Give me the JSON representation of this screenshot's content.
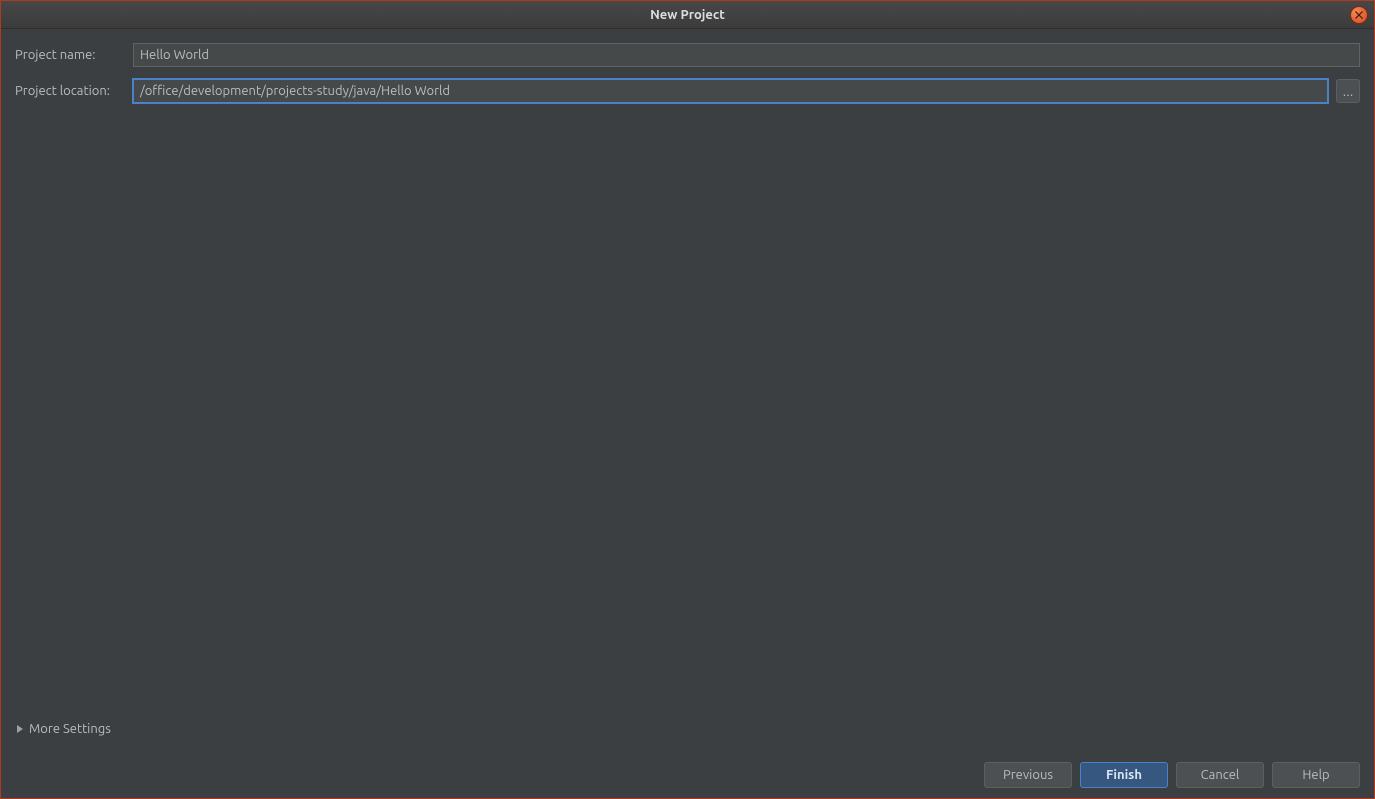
{
  "window": {
    "title": "New Project"
  },
  "form": {
    "project_name_label": "Project name:",
    "project_name_value": "Hello World",
    "project_location_label": "Project location:",
    "project_location_value": "/office/development/projects-study/java/Hello World",
    "browse_label": "..."
  },
  "more_settings": {
    "label": "More Settings"
  },
  "buttons": {
    "previous": "Previous",
    "finish": "Finish",
    "cancel": "Cancel",
    "help": "Help"
  }
}
